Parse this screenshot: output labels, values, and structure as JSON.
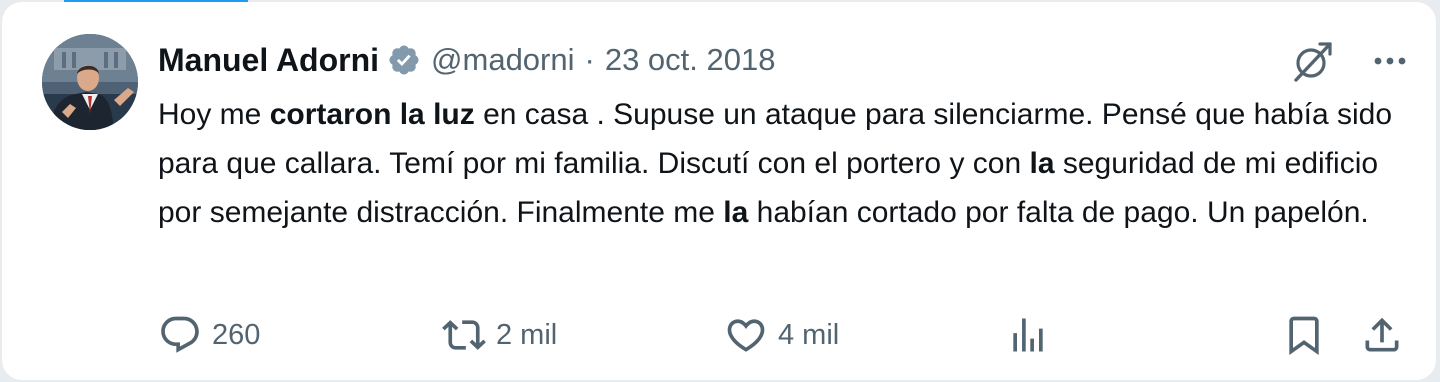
{
  "author": {
    "name": "Manuel Adorni",
    "handle": "@madorni",
    "separator": "·",
    "date": "23 oct. 2018",
    "verified_icon": "verified-badge-icon",
    "avatar": "avatar-photo"
  },
  "tweet": {
    "segments": [
      {
        "text": "Hoy me ",
        "bold": false
      },
      {
        "text": "cortaron la luz",
        "bold": true
      },
      {
        "text": " en casa . Supuse un ataque para silenciarme. Pensé que había sido para que callara. Temí por mi familia. Discutí con el portero y con ",
        "bold": false
      },
      {
        "text": "la",
        "bold": true
      },
      {
        "text": " seguridad de mi edificio por semejante distracción. Finalmente me ",
        "bold": false
      },
      {
        "text": "la",
        "bold": true
      },
      {
        "text": " habían cortado por falta de pago. Un papelón.",
        "bold": false
      }
    ]
  },
  "actions": {
    "reply_count": "260",
    "repost_count": "2 mil",
    "like_count": "4 mil"
  },
  "colors": {
    "text_primary": "#0f1419",
    "text_secondary": "#536471",
    "verified": "#829aab",
    "accent": "#1d9bf0"
  },
  "icons": [
    "grok-icon",
    "more-icon",
    "reply-icon",
    "repost-icon",
    "like-icon",
    "views-icon",
    "bookmark-icon",
    "share-icon"
  ]
}
